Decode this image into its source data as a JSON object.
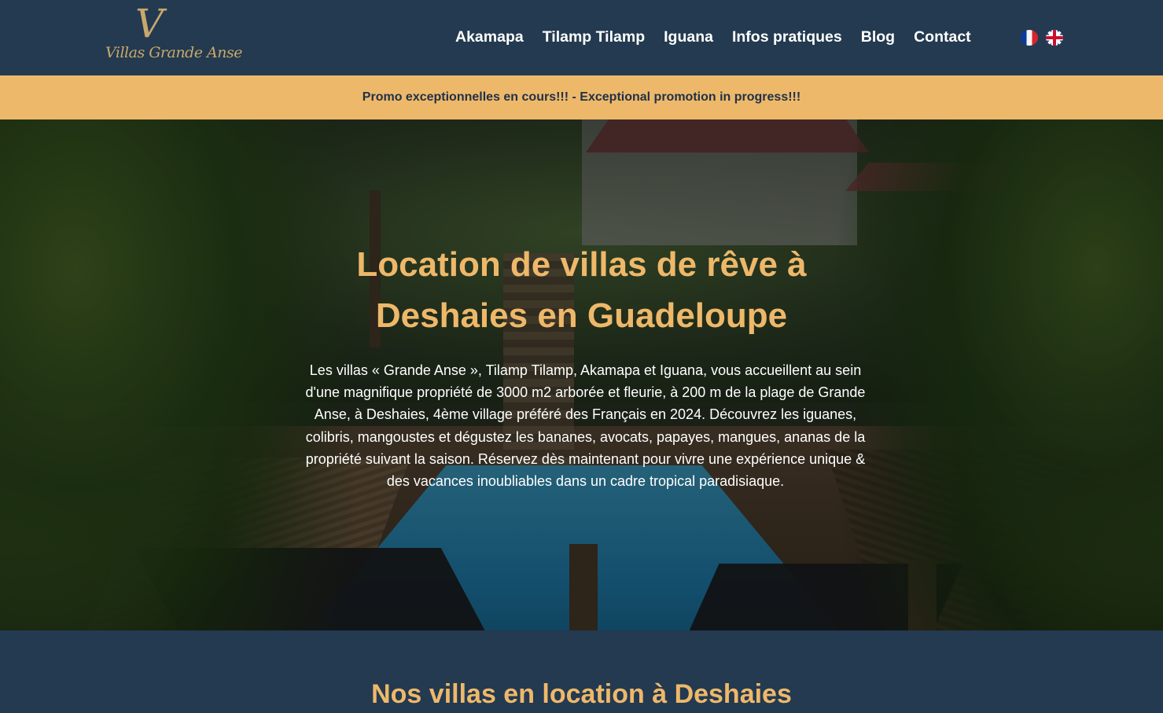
{
  "header": {
    "logo_letter": "V",
    "logo_text": "Villas Grande Anse",
    "nav": [
      "Akamapa",
      "Tilamp Tilamp",
      "Iguana",
      "Infos pratiques",
      "Blog",
      "Contact"
    ]
  },
  "languages": [
    "fr",
    "en"
  ],
  "promo": "Promo exceptionnelles en cours!!! - Exceptional promotion in progress!!!",
  "hero": {
    "title_line1": "Location de villas de rêve à",
    "title_line2": "Deshaies en Guadeloupe",
    "text": "Les villas « Grande Anse », Tilamp Tilamp, Akamapa et Iguana, vous accueillent au sein d'une magnifique propriété de 3000 m2 arborée et fleurie, à 200 m de la plage de Grande Anse, à Deshaies, 4ème village préféré des Français en 2024. Découvrez les iguanes, colibris, mangoustes et dégustez les bananes, avocats, papayes, mangues, ananas de la propriété suivant la saison. Réservez dès maintenant pour vivre une expérience unique & des vacances inoubliables dans un cadre tropical paradisiaque."
  },
  "section": {
    "title": "Nos villas en location à Deshaies"
  },
  "colors": {
    "navy": "#233a50",
    "gold": "#eeb86a",
    "logo_gold": "#caa86c"
  }
}
